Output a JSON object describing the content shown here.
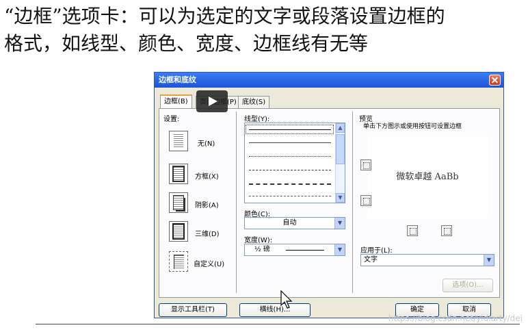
{
  "heading": {
    "line1": "“边框”选项卡：可以为选定的文字或段落设置边框的",
    "line2": "格式，如线型、颜色、宽度、边框线有无等"
  },
  "dialog": {
    "title": "边框和底纹",
    "tabs": [
      "边框(B)",
      "页面边框(P)",
      "底纹(S)"
    ],
    "settings": {
      "label": "设置:",
      "items": [
        "无(N)",
        "方框(X)",
        "阴影(A)",
        "三维(D)",
        "自定义(U)"
      ]
    },
    "style": {
      "label": "线型(Y):"
    },
    "color": {
      "label": "颜色(C):",
      "value": "自动"
    },
    "width": {
      "label": "宽度(W):",
      "value": "½ 磅"
    },
    "preview": {
      "label": "预览",
      "hint": "单击下方图示或使用按钮可设置边框",
      "sample_text": "微软卓越 AaBb"
    },
    "apply_to": {
      "label": "应用于(L):",
      "value": "文字"
    },
    "options_button": "选项(O)...",
    "buttons": {
      "toolbar": "显示工具栏(T)",
      "hline": "横线(H)...",
      "ok": "确定",
      "cancel": "取消"
    }
  },
  "watermark": "https://blog.csdn.net/yidiarty/dei",
  "colors": {
    "title_bar": "#1d53d9",
    "dialog_bg": "#ece9d8",
    "close_button": "#d5492a"
  }
}
